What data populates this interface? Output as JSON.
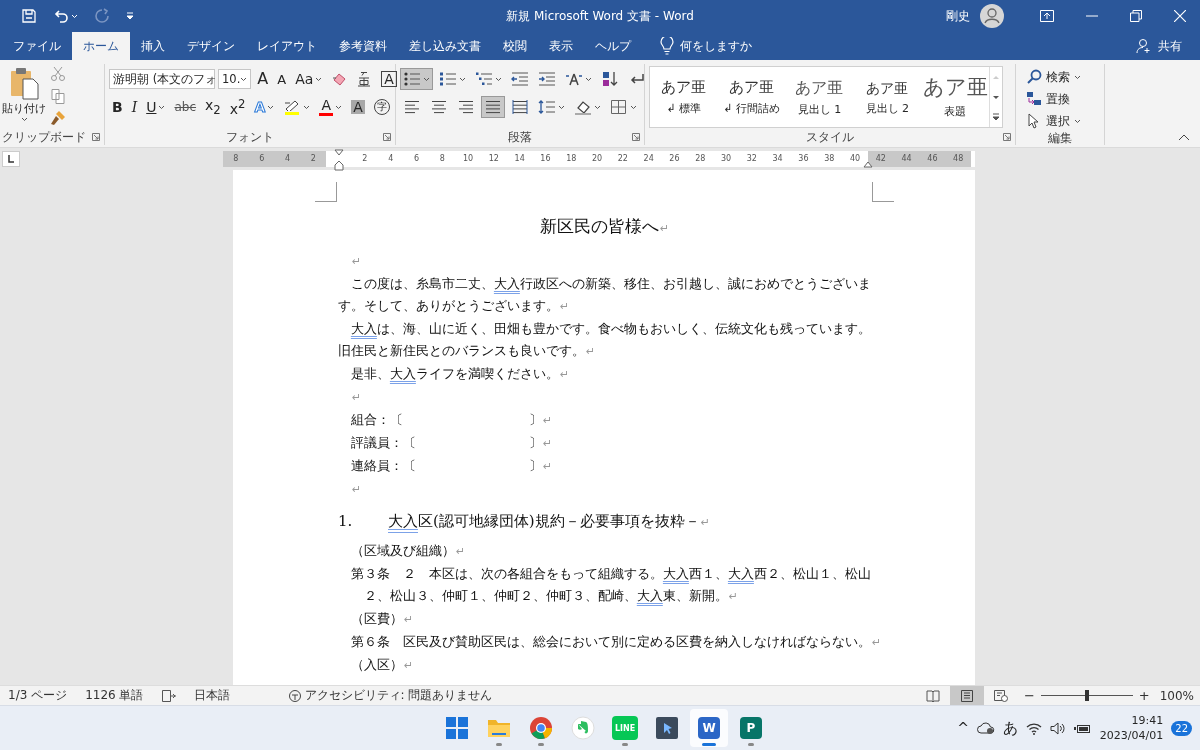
{
  "title_bar": {
    "title": "新規 Microsoft Word 文書  -  Word",
    "user": "剛史",
    "quick_access": [
      {
        "kind": "save",
        "disabled": false
      },
      {
        "kind": "undo",
        "disabled": false
      },
      {
        "kind": "redo",
        "disabled": true
      },
      {
        "kind": "customize",
        "disabled": false
      }
    ]
  },
  "tabs": [
    {
      "label": "ファイル",
      "selected": false
    },
    {
      "label": "ホーム",
      "selected": true
    },
    {
      "label": "挿入",
      "selected": false
    },
    {
      "label": "デザイン",
      "selected": false
    },
    {
      "label": "レイアウト",
      "selected": false
    },
    {
      "label": "参考資料",
      "selected": false
    },
    {
      "label": "差し込み文書",
      "selected": false
    },
    {
      "label": "校閲",
      "selected": false
    },
    {
      "label": "表示",
      "selected": false
    },
    {
      "label": "ヘルプ",
      "selected": false
    }
  ],
  "tell_me": {
    "placeholder": "何をしますか"
  },
  "share": {
    "label": "共有"
  },
  "ribbon": {
    "clipboard": {
      "paste": "貼り付け",
      "label": "クリップボード"
    },
    "font": {
      "name": "游明朝 (本文のフォ",
      "size": "10.",
      "label": "フォント",
      "row1": [
        {
          "kind": "grow",
          "label": "A",
          "dropdown": false
        },
        {
          "kind": "shrink",
          "label": "A",
          "dropdown": false
        },
        {
          "kind": "case",
          "label": "Aa",
          "dropdown": true
        },
        {
          "kind": "clear",
          "dropdown": false
        },
        {
          "kind": "phonetic",
          "dropdown": false
        },
        {
          "kind": "border",
          "label": "A",
          "dropdown": false
        }
      ],
      "row2": [
        {
          "kind": "bold",
          "label": "B",
          "dropdown": false
        },
        {
          "kind": "italic",
          "label": "I",
          "dropdown": false
        },
        {
          "kind": "underline",
          "label": "U",
          "dropdown": true
        },
        {
          "kind": "strike",
          "label": "abc",
          "dropdown": false
        },
        {
          "kind": "sub",
          "label": "x$_{2}$",
          "dropdown": false
        },
        {
          "kind": "sup",
          "label": "x$^{2}$",
          "dropdown": false
        },
        {
          "kind": "effect",
          "label": "A",
          "dropdown": true
        },
        {
          "kind": "highlight",
          "color": "#ffff00",
          "dropdown": true
        },
        {
          "kind": "color",
          "label": "A",
          "color": "#ff0000",
          "dropdown": true
        },
        {
          "kind": "shade",
          "label": "A",
          "dropdown": false
        },
        {
          "kind": "enclose",
          "label": "字",
          "dropdown": false
        }
      ]
    },
    "paragraph": {
      "label": "段落",
      "row1": [
        {
          "kind": "bullets",
          "selected": true,
          "dropdown": true
        },
        {
          "kind": "numbering",
          "selected": false,
          "dropdown": true
        },
        {
          "kind": "multilevel",
          "selected": false,
          "dropdown": true
        },
        {
          "kind": "outdent",
          "selected": false,
          "dropdown": false
        },
        {
          "kind": "indent",
          "selected": false,
          "dropdown": false
        },
        {
          "kind": "asian",
          "selected": false,
          "dropdown": true
        },
        {
          "kind": "sort",
          "selected": false,
          "dropdown": false
        },
        {
          "kind": "marks",
          "selected": false,
          "dropdown": false
        }
      ],
      "row2": [
        {
          "kind": "left",
          "selected": false,
          "dropdown": false
        },
        {
          "kind": "center",
          "selected": false,
          "dropdown": false
        },
        {
          "kind": "right",
          "selected": false,
          "dropdown": false
        },
        {
          "kind": "justify",
          "selected": true,
          "dropdown": false
        },
        {
          "kind": "distributed",
          "selected": false,
          "dropdown": false
        },
        {
          "kind": "spacing",
          "selected": false,
          "dropdown": true
        },
        {
          "kind": "shading",
          "selected": false,
          "dropdown": true
        },
        {
          "kind": "borders",
          "selected": false,
          "dropdown": true
        }
      ]
    },
    "styles": {
      "label": "スタイル",
      "items": [
        {
          "kind": "normal",
          "sample": "あア亜",
          "name": "↲ 標準"
        },
        {
          "kind": "compact",
          "sample": "あア亜",
          "name": "↲ 行間詰め"
        },
        {
          "kind": "h1",
          "sample": "あア亜",
          "name": "見出し 1"
        },
        {
          "kind": "h2",
          "sample": "あア亜",
          "name": "見出し 2"
        },
        {
          "kind": "title",
          "sample": "あア亜",
          "name": "表題"
        }
      ]
    },
    "editing": {
      "label": "編集",
      "items": [
        {
          "kind": "find",
          "label": "検索",
          "dropdown": true
        },
        {
          "kind": "replace",
          "label": "置換",
          "dropdown": false
        },
        {
          "kind": "select",
          "label": "選択",
          "dropdown": true
        }
      ]
    }
  },
  "ruler": {
    "left_marks": [
      "8",
      "6",
      "4",
      "2"
    ],
    "right_marks": [
      {
        "label": "2",
        "margin": false
      },
      {
        "label": "4",
        "margin": false
      },
      {
        "label": "6",
        "margin": false
      },
      {
        "label": "8",
        "margin": false
      },
      {
        "label": "10",
        "margin": false
      },
      {
        "label": "12",
        "margin": false
      },
      {
        "label": "14",
        "margin": false
      },
      {
        "label": "16",
        "margin": false
      },
      {
        "label": "18",
        "margin": false
      },
      {
        "label": "20",
        "margin": false
      },
      {
        "label": "22",
        "margin": false
      },
      {
        "label": "24",
        "margin": false
      },
      {
        "label": "26",
        "margin": false
      },
      {
        "label": "28",
        "margin": false
      },
      {
        "label": "30",
        "margin": false
      },
      {
        "label": "32",
        "margin": false
      },
      {
        "label": "34",
        "margin": false
      },
      {
        "label": "36",
        "margin": false
      },
      {
        "label": "38",
        "margin": false
      },
      {
        "label": "40",
        "margin": false
      },
      {
        "label": "42",
        "margin": true
      },
      {
        "label": "44",
        "margin": true
      },
      {
        "label": "46",
        "margin": true
      },
      {
        "label": "48",
        "margin": true
      }
    ]
  },
  "document": {
    "title": "新区民の皆様へ",
    "title_mark": "↵",
    "blocks": [
      {
        "kind": "empty",
        "mark": "↵"
      },
      {
        "kind": "para",
        "runs": [
          {
            "text": "この度は、糸島市二丈、",
            "flagged": false
          },
          {
            "text": "大入",
            "flagged": true
          },
          {
            "text": "行政区への新築、移住、お引越し、誠におめでとうございます。そして、ありがとうございます。",
            "flagged": false
          }
        ],
        "mark": "↵"
      },
      {
        "kind": "para",
        "runs": [
          {
            "text": "大入",
            "flagged": true
          },
          {
            "text": "は、海、山に近く、田畑も豊かです。食べ物もおいしく、伝統文化も残っています。旧住民と新住民とのバランスも良いです。",
            "flagged": false
          }
        ],
        "mark": "↵"
      },
      {
        "kind": "para",
        "runs": [
          {
            "text": "是非、",
            "flagged": false
          },
          {
            "text": "大入",
            "flagged": true
          },
          {
            "text": "ライフを満喫ください。",
            "flagged": false
          }
        ],
        "mark": "↵"
      },
      {
        "kind": "empty",
        "mark": "↵"
      },
      {
        "kind": "field",
        "label": "組合：〔",
        "close": "〕",
        "mark": "↵"
      },
      {
        "kind": "field",
        "label": "評議員：〔",
        "close": "〕",
        "mark": "↵"
      },
      {
        "kind": "field",
        "label": "連絡員：〔",
        "close": "〕",
        "mark": "↵"
      },
      {
        "kind": "empty",
        "mark": "↵"
      },
      {
        "kind": "heading",
        "number": "1.",
        "runs": [
          {
            "text": "大入",
            "flagged": true
          },
          {
            "text": "区(認可地縁団体)規約－必要事項を抜粋－",
            "flagged": false
          }
        ],
        "mark": "↵"
      },
      {
        "kind": "caption",
        "runs": [
          {
            "text": "（区域及び組織）",
            "flagged": false
          }
        ],
        "mark": "↵"
      },
      {
        "kind": "article",
        "runs": [
          {
            "text": "第３条　２　本区は、次の各組合をもって組織する。",
            "flagged": false
          },
          {
            "text": "大入",
            "flagged": true
          },
          {
            "text": "西１、",
            "flagged": false
          },
          {
            "text": "大入",
            "flagged": true
          },
          {
            "text": "西２、松山１、松山２、松山３、仲町１、仲町２、仲町３、配崎、",
            "flagged": false
          },
          {
            "text": "大入",
            "flagged": true
          },
          {
            "text": "東、新開。",
            "flagged": false
          }
        ],
        "mark": "↵"
      },
      {
        "kind": "caption",
        "runs": [
          {
            "text": "（区費）",
            "flagged": false
          }
        ],
        "mark": "↵"
      },
      {
        "kind": "article",
        "runs": [
          {
            "text": "第６条　区民及び賛助区民は、総会において別に定める区費を納入しなければならない。",
            "flagged": false
          }
        ],
        "mark": "↵"
      },
      {
        "kind": "caption",
        "runs": [
          {
            "text": "（入区）",
            "flagged": false
          }
        ],
        "mark": "↵"
      }
    ]
  },
  "status_bar": {
    "page": "1/3 ページ",
    "words": "1126 単語",
    "language": "日本語",
    "accessibility": "アクセシビリティ: 問題ありません",
    "views": [
      {
        "kind": "read",
        "selected": false
      },
      {
        "kind": "print",
        "selected": true
      },
      {
        "kind": "web",
        "selected": false
      }
    ],
    "zoom": {
      "minus": "−",
      "plus": "+",
      "level": 0.5,
      "value": "100%"
    }
  },
  "taskbar": {
    "apps": [
      {
        "kind": "start",
        "running": false,
        "active": false
      },
      {
        "kind": "explorer",
        "running": true,
        "active": false
      },
      {
        "kind": "browser",
        "running": true,
        "active": false
      },
      {
        "kind": "notes",
        "running": false,
        "active": false
      },
      {
        "kind": "chat",
        "label": "LINE",
        "running": true,
        "active": false
      },
      {
        "kind": "app",
        "running": false,
        "active": false
      },
      {
        "kind": "word",
        "label": "W",
        "running": true,
        "active": true
      },
      {
        "kind": "publisher",
        "label": "P",
        "running": true,
        "active": false
      }
    ],
    "tray": {
      "chevron": "^",
      "ime": "あ",
      "time": "19:41",
      "date": "2023/04/01",
      "badge": "22"
    }
  }
}
